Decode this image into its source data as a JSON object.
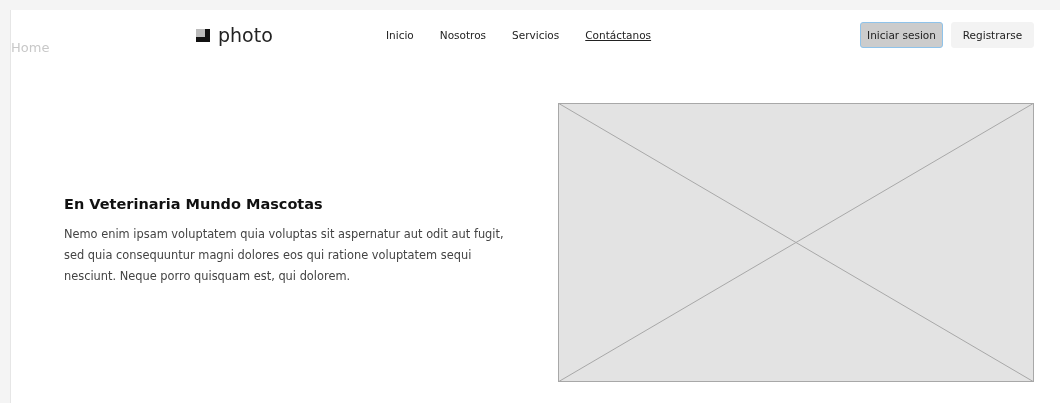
{
  "frame_label": "Home",
  "logo": {
    "text": "photo"
  },
  "nav": [
    {
      "label": "Inicio",
      "selected": false
    },
    {
      "label": "Nosotros",
      "selected": false
    },
    {
      "label": "Servicios",
      "selected": false
    },
    {
      "label": "Contáctanos",
      "selected": true
    }
  ],
  "buttons": [
    {
      "label": "Iniciar sesion",
      "kind": "primary"
    },
    {
      "label": "Registrarse",
      "kind": "secondary"
    }
  ],
  "hero": {
    "title": "En Veterinaria Mundo Mascotas",
    "text": "Nemo enim ipsam voluptatem quia voluptas sit aspernatur aut odit aut fugit, sed quia consequuntur magni dolores eos qui ratione voluptatem sequi nesciunt. Neque porro quisquam est, qui dolorem."
  }
}
